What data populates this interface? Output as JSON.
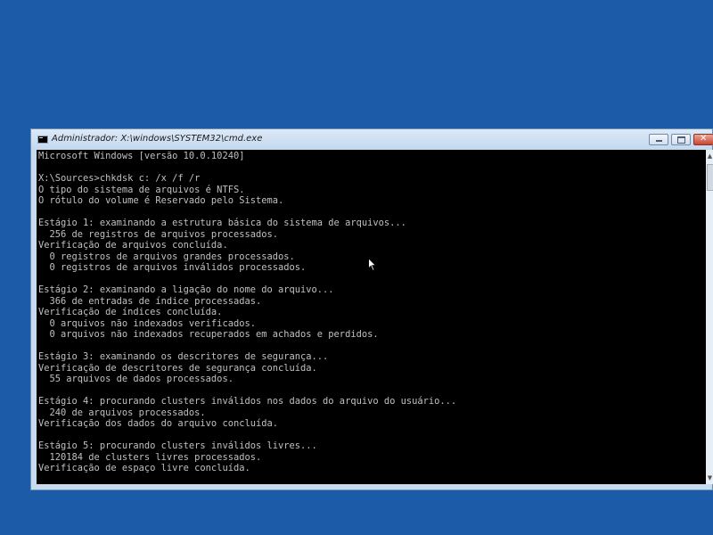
{
  "window": {
    "title": "Administrador: X:\\windows\\SYSTEM32\\cmd.exe",
    "icon": "cmd-app-icon",
    "controls": {
      "minimize_icon": "minimize-icon",
      "maximize_icon": "maximize-icon",
      "close_icon": "close-icon"
    }
  },
  "console": {
    "text": "Microsoft Windows [versão 10.0.10240]\n\nX:\\Sources>chkdsk c: /x /f /r\nO tipo do sistema de arquivos é NTFS.\nO rótulo do volume é Reservado pelo Sistema.\n\nEstágio 1: examinando a estrutura básica do sistema de arquivos...\n  256 de registros de arquivos processados.\nVerificação de arquivos concluída.\n  0 registros de arquivos grandes processados.\n  0 registros de arquivos inválidos processados.\n\nEstágio 2: examinando a ligação do nome do arquivo...\n  366 de entradas de índice processadas.\nVerificação de índices concluída.\n  0 arquivos não indexados verificados.\n  0 arquivos não indexados recuperados em achados e perdidos.\n\nEstágio 3: examinando os descritores de segurança...\nVerificação de descritores de segurança concluída.\n  55 arquivos de dados processados.\n\nEstágio 4: procurando clusters inválidos nos dados do arquivo do usuário...\n  240 de arquivos processados.\nVerificação dos dados do arquivo concluída.\n\nEstágio 5: procurando clusters inválidos livres...\n  120184 de clusters livres processados.\nVerificação de espaço livre concluída.",
    "background": "#000000",
    "foreground": "#c0c0c0"
  },
  "desktop": {
    "background": "#1c5ba8"
  },
  "pointer": {
    "icon": "arrow-cursor-icon"
  }
}
